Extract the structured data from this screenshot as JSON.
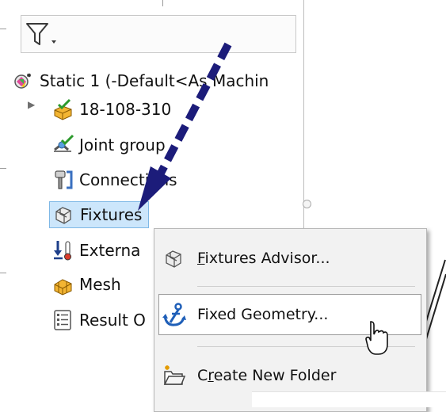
{
  "tree": {
    "study": "Static 1 (-Default<As Machin",
    "items": [
      {
        "label": "18-108-310",
        "icon": "part-check-icon"
      },
      {
        "label": "Joint group",
        "icon": "joint-group-icon"
      },
      {
        "label": "Connections",
        "icon": "connections-icon"
      },
      {
        "label": "Fixtures",
        "icon": "fixtures-icon"
      },
      {
        "label": "Externa",
        "icon": "external-loads-icon"
      },
      {
        "label": "Mesh",
        "icon": "mesh-icon"
      },
      {
        "label": "Result O",
        "icon": "result-options-icon"
      }
    ]
  },
  "context_menu": {
    "items": [
      {
        "label": "Fixtures Advisor...",
        "accel": "F",
        "icon": "fixtures-advisor-icon"
      },
      {
        "label": "Fixed Geometry...",
        "accel": "",
        "icon": "anchor-icon"
      },
      {
        "label": "Create New Folder",
        "accel": "r",
        "icon": "new-folder-icon"
      }
    ]
  },
  "colors": {
    "selection_bg": "#cce6fb",
    "annotation_arrow": "#1c1c7a",
    "menu_bg": "#f2f2f2"
  }
}
